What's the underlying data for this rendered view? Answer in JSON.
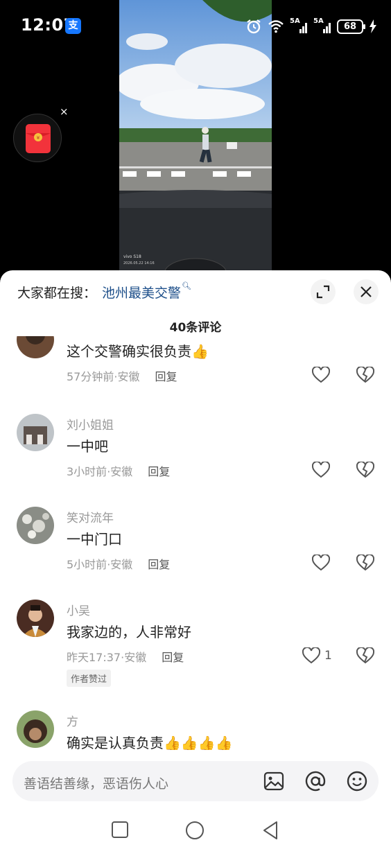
{
  "status_bar": {
    "time": "12:07",
    "alipay_badge": "支",
    "net1": "5A",
    "net2": "5A",
    "battery": "68"
  },
  "video": {
    "watermark_device": "vivo S18",
    "watermark_date": "2026.05.22 14:16"
  },
  "sheet": {
    "search_prefix": "大家都在搜：",
    "search_term": "池州最美交警",
    "comment_count": "40条评论"
  },
  "comments": [
    {
      "user": "",
      "text": "这个交警确实很负责👍",
      "time": "57分钟前",
      "location": "安徽",
      "reply": "回复",
      "likes": ""
    },
    {
      "user": "刘小姐姐",
      "text": "一中吧",
      "time": "3小时前",
      "location": "安徽",
      "reply": "回复",
      "likes": ""
    },
    {
      "user": "笑对流年",
      "text": "一中门口",
      "time": "5小时前",
      "location": "安徽",
      "reply": "回复",
      "likes": ""
    },
    {
      "user": "小吴",
      "text": "我家边的，人非常好",
      "time": "昨天17:37",
      "location": "安徽",
      "reply": "回复",
      "likes": "1",
      "badge": "作者赞过"
    },
    {
      "user": "方",
      "text": "确实是认真负责👍👍👍👍",
      "time": "",
      "location": "",
      "reply": "",
      "likes": ""
    }
  ],
  "input": {
    "placeholder": "善语结善缘，恶语伤人心"
  },
  "icons": [
    "alarm-icon",
    "wifi-icon",
    "signal-icon",
    "battery-icon",
    "charging-icon",
    "red-envelope-icon",
    "expand-icon",
    "close-icon",
    "heart-icon",
    "broken-heart-icon",
    "image-icon",
    "at-icon",
    "emoji-icon",
    "recent-apps-icon",
    "home-icon",
    "back-icon"
  ],
  "colors": {
    "search_term": "#1d4f8a",
    "alipay": "#1677ff",
    "red_envelope": "#f2333b"
  }
}
